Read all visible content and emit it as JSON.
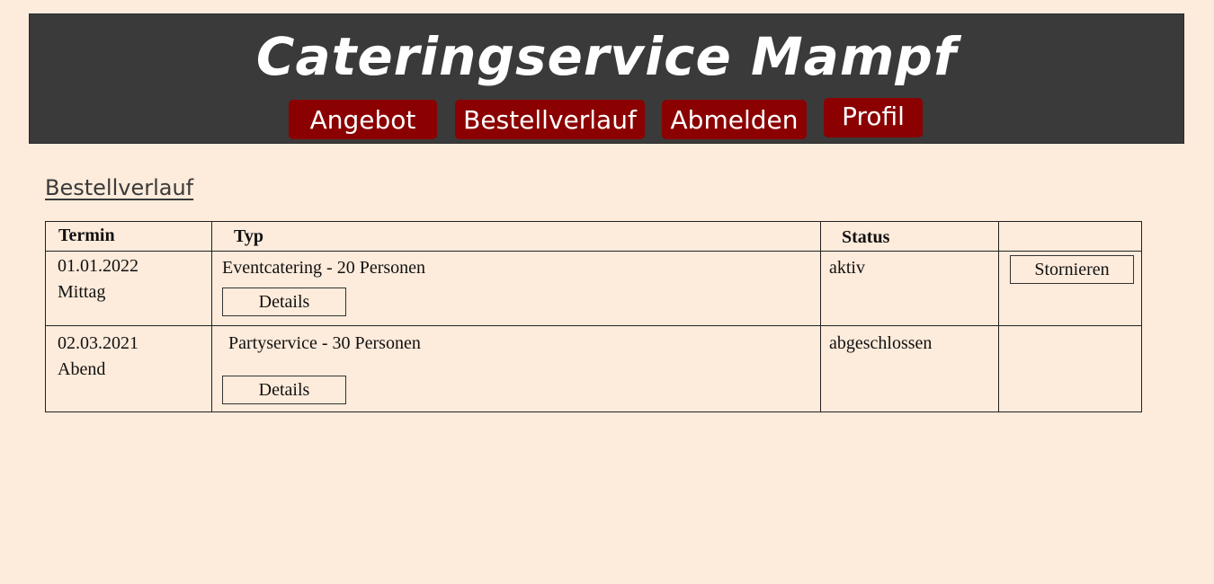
{
  "header": {
    "title": "Cateringservice Mampf",
    "nav": {
      "angebot": "Angebot",
      "bestellverlauf": "Bestellverlauf",
      "abmelden": "Abmelden",
      "profil": "Profil"
    }
  },
  "page": {
    "heading": "Bestellverlauf"
  },
  "table": {
    "headers": {
      "termin": "Termin",
      "typ": "Typ",
      "status": "Status",
      "action": ""
    },
    "rows": [
      {
        "date": "01.01.2022",
        "time": "Mittag",
        "type": "Eventcatering - 20 Personen",
        "details_label": "Details",
        "status": "aktiv",
        "action_label": "Stornieren"
      },
      {
        "date": "02.03.2021",
        "time": "Abend",
        "type": "Partyservice - 30 Personen",
        "details_label": "Details",
        "status": "abgeschlossen",
        "action_label": ""
      }
    ]
  },
  "colors": {
    "background": "#fdebdb",
    "header_bg": "#3a3a3a",
    "nav_button": "#8b0000"
  }
}
